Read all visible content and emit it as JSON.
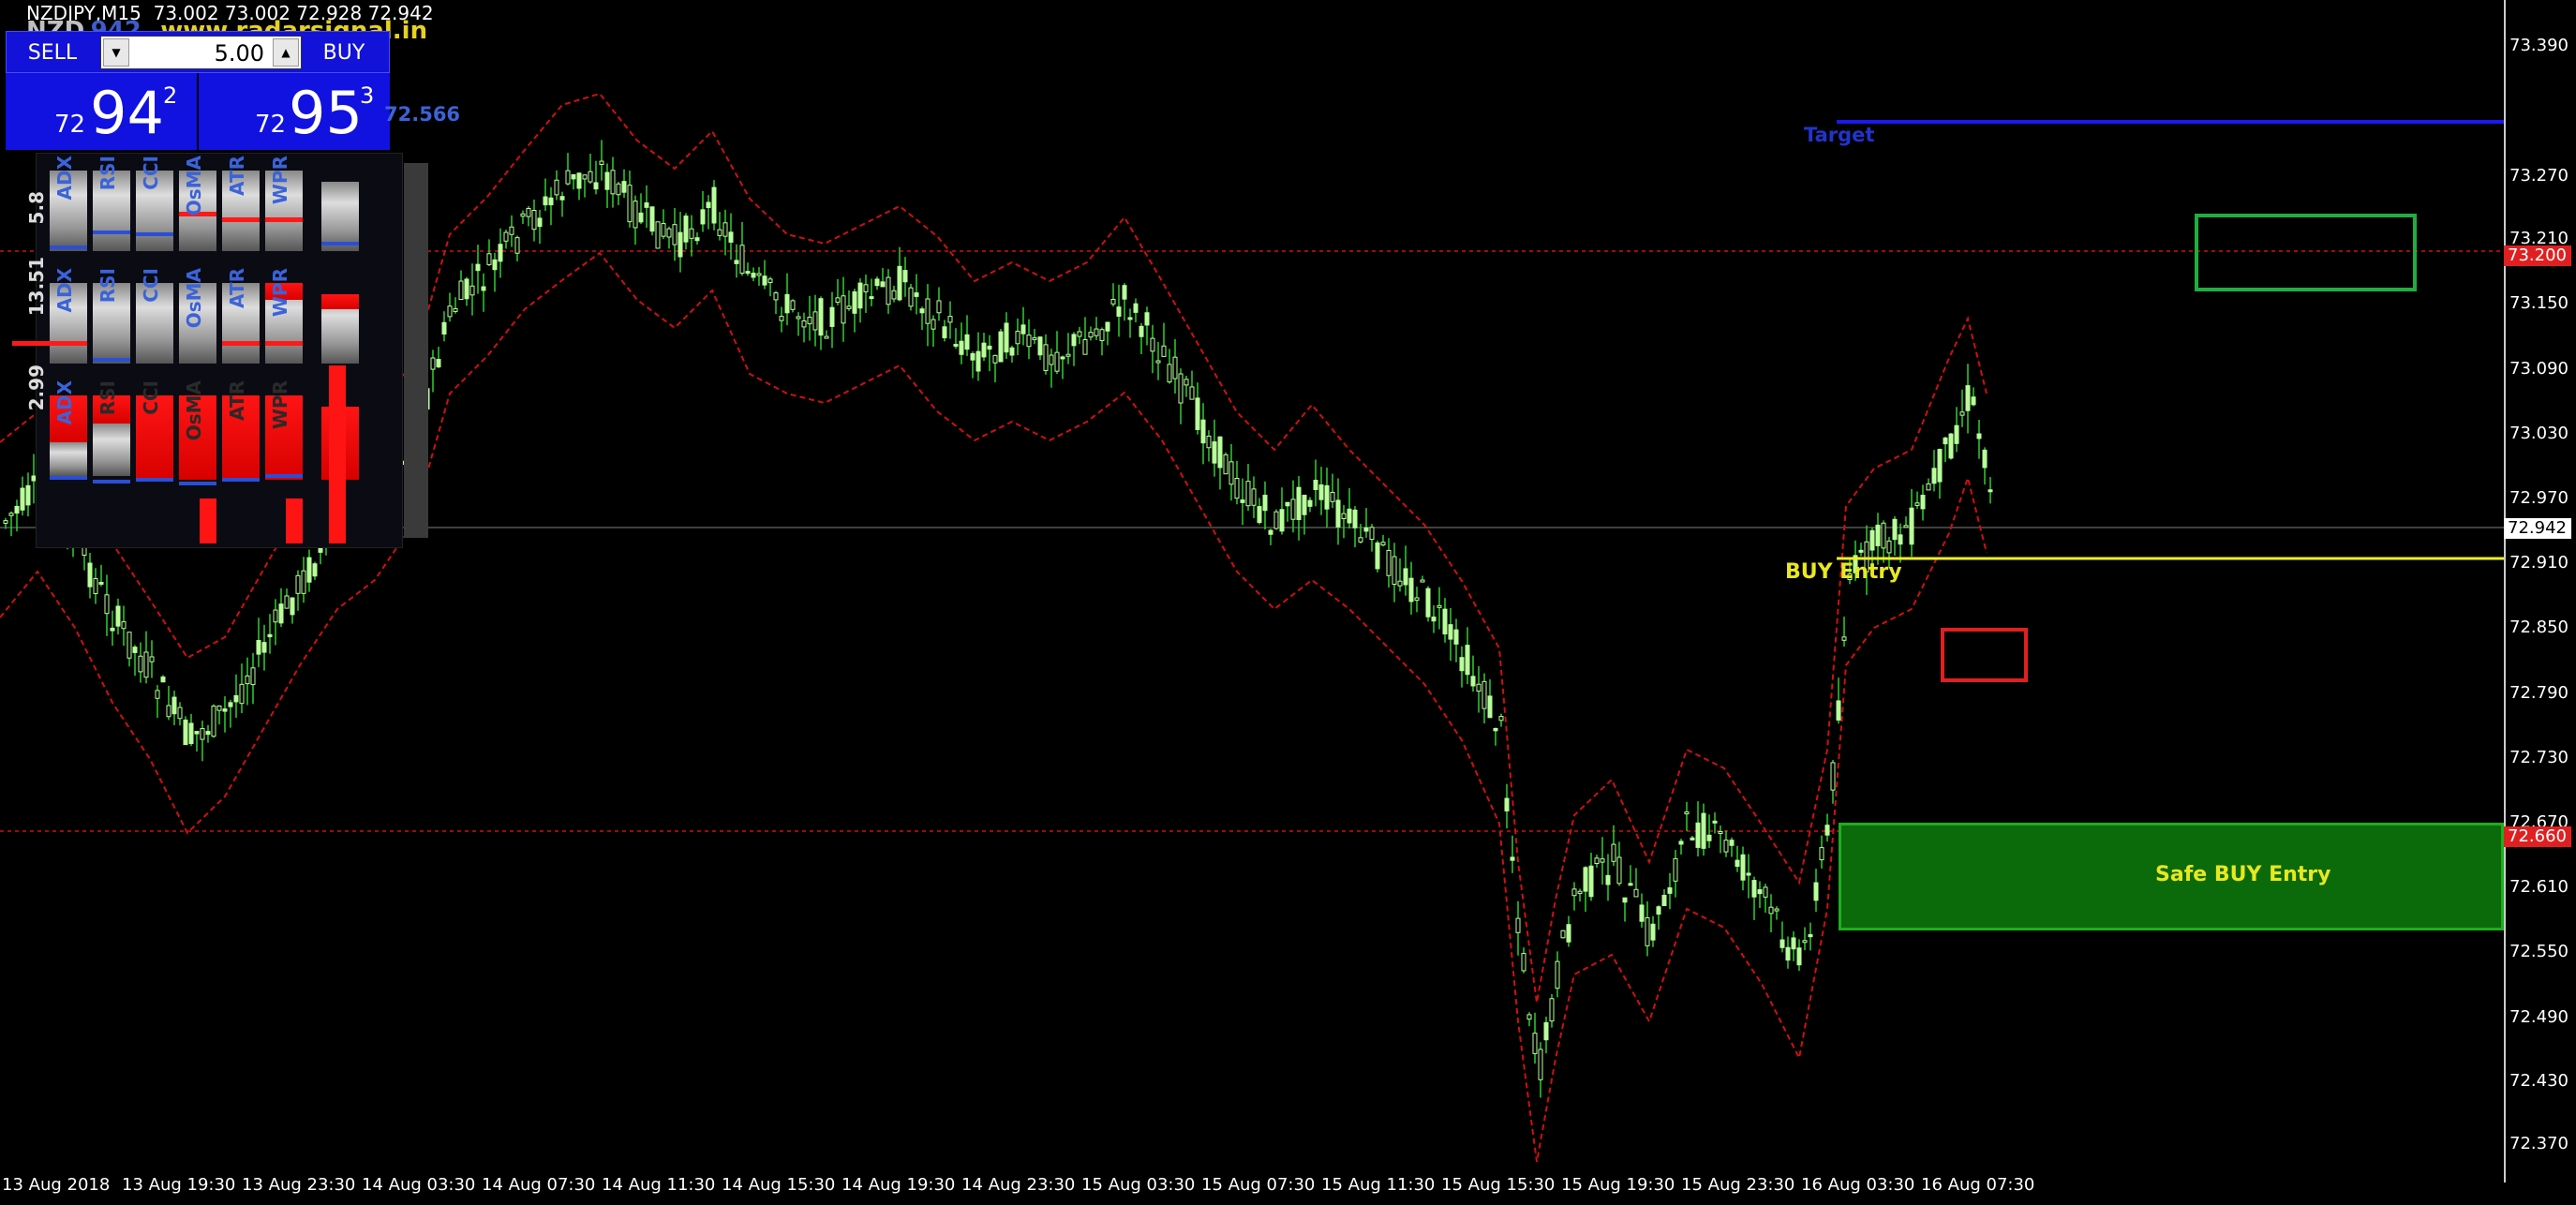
{
  "header": {
    "symbol": "NZDJPY,M15",
    "ohlc": "73.002 73.002 72.928 72.942",
    "sym_overlay": "NZD",
    "num_overlay": "942",
    "site": "www.radarsignal.in"
  },
  "trade_panel": {
    "sell_label": "SELL",
    "buy_label": "BUY",
    "lots": "5.00",
    "bid": {
      "prefix": "72",
      "big": "94",
      "sup": "2"
    },
    "ask": {
      "prefix": "72",
      "big": "95",
      "sup": "3"
    }
  },
  "side_price": "72.566",
  "indicators": {
    "labels": [
      "ADX",
      "RSI",
      "CCI",
      "OsMA",
      "ATR",
      "WPR"
    ],
    "side_values": [
      "5.8",
      "13.51",
      "2.99"
    ]
  },
  "price_axis": {
    "ticks": [
      "73.390",
      "73.270",
      "73.210",
      "73.150",
      "73.090",
      "73.030",
      "72.970",
      "72.910",
      "72.850",
      "72.790",
      "72.730",
      "72.670",
      "72.610",
      "72.550",
      "72.490",
      "72.430",
      "72.370"
    ],
    "marker_high": "73.200",
    "marker_current": "72.942",
    "marker_low": "72.660"
  },
  "time_axis": [
    "13 Aug 2018",
    "13 Aug 19:30",
    "13 Aug 23:30",
    "14 Aug 03:30",
    "14 Aug 07:30",
    "14 Aug 11:30",
    "14 Aug 15:30",
    "14 Aug 19:30",
    "14 Aug 23:30",
    "15 Aug 03:30",
    "15 Aug 07:30",
    "15 Aug 11:30",
    "15 Aug 15:30",
    "15 Aug 19:30",
    "15 Aug 23:30",
    "16 Aug 03:30",
    "16 Aug 07:30"
  ],
  "annotations": {
    "target": "Target",
    "buy_entry": "BUY Entry",
    "safe_buy": "Safe BUY Entry"
  },
  "colors": {
    "candle": "#b8ff9a",
    "wick": "#2fcf2f",
    "band": "#d01010",
    "target_line": "#1a1af0",
    "buy_line": "#f0f020",
    "safe_zone": "#0b6b0b"
  }
}
